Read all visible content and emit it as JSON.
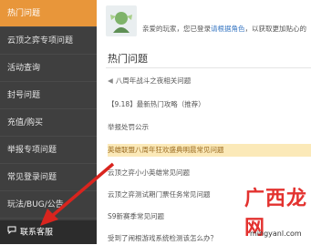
{
  "sidebar": {
    "items": [
      {
        "label": "热门问题",
        "active": true
      },
      {
        "label": "云顶之弈专项问题",
        "active": false
      },
      {
        "label": "活动查询",
        "active": false
      },
      {
        "label": "封号问题",
        "active": false
      },
      {
        "label": "充值/购买",
        "active": false
      },
      {
        "label": "举报专项问题",
        "active": false
      },
      {
        "label": "常见登录问题",
        "active": false
      },
      {
        "label": "玩法/BUG/公告",
        "active": false
      }
    ],
    "support_label": "联系客服"
  },
  "main": {
    "greeting_prefix": "亲爱的玩家，您已登录",
    "greeting_link": "请根据角色",
    "greeting_suffix": "，以获取更加贴心的",
    "hot_title": "热门问题",
    "faqs": [
      {
        "text": "八周年战斗之夜相关问题",
        "highlight": false,
        "speaker": true
      },
      {
        "text": "【9.18】最新热门攻略（推荐）",
        "highlight": false,
        "speaker": false
      },
      {
        "text": "举报处罚公示",
        "highlight": false,
        "speaker": false
      },
      {
        "text": "英雄联盟八周年狂欢盛典明晨常见问题",
        "highlight": true,
        "speaker": false
      },
      {
        "text": "云顶之弈小小英雄常见问题",
        "highlight": false,
        "speaker": false
      },
      {
        "text": "云顶之弈测试期门票任务常见问题",
        "highlight": false,
        "speaker": false
      },
      {
        "text": "S9新赛季常见问题",
        "highlight": false,
        "speaker": false
      },
      {
        "text": "受到了闹根游戏系统检测该怎么办？",
        "highlight": false,
        "speaker": false
      }
    ]
  },
  "watermark": {
    "logo": "广西龙网",
    "url": "mingyanl.com"
  },
  "colors": {
    "sidebar_bg": "#3f3f3f",
    "active_bg": "#e8963a",
    "highlight_bg": "#fbe9b8",
    "arrow": "#d9241e"
  }
}
